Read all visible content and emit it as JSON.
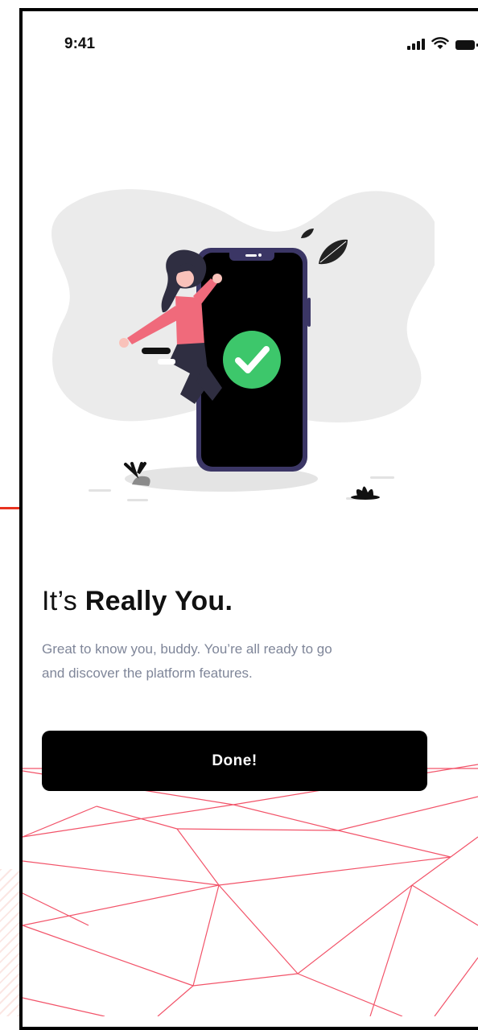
{
  "status_bar": {
    "time": "9:41",
    "icons": [
      "signal-icon",
      "wifi-icon",
      "battery-icon"
    ]
  },
  "illustration": {
    "name": "woman-jumping-next-to-phone-with-checkmark",
    "icons": [
      "check-circle-icon",
      "leaf-icon",
      "plant-icon"
    ]
  },
  "headline": {
    "light": "It’s ",
    "bold": "Really You."
  },
  "subtitle": {
    "line1": "Great to know you, buddy. You’re all ready to go",
    "line2": "and discover the platform features."
  },
  "done_button": {
    "label": "Done!"
  },
  "colors": {
    "accent_pink": "#f06a7b",
    "check_green": "#3dc76b",
    "phone_frame": "#3b3665",
    "button_bg": "#000000",
    "subtitle_text": "#7f8699",
    "line_red": "#f0364f"
  }
}
